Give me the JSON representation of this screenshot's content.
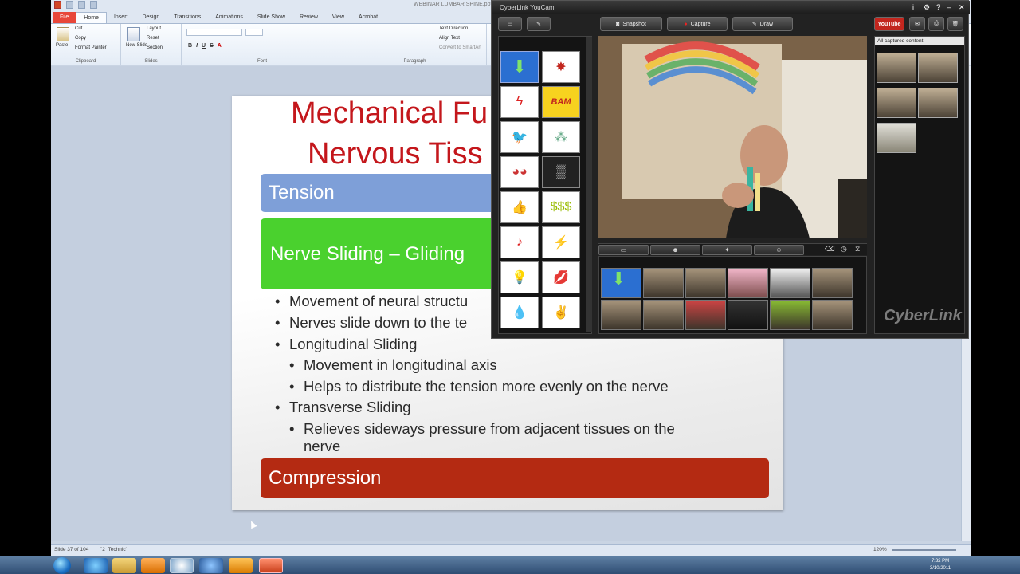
{
  "powerpoint": {
    "file_name": "WEBINAR LUMBAR SPINE.pptx",
    "tabs": [
      "File",
      "Home",
      "Insert",
      "Design",
      "Transitions",
      "Animations",
      "Slide Show",
      "Review",
      "View",
      "Acrobat"
    ],
    "clipboard": {
      "paste": "Paste",
      "cut": "Cut",
      "copy": "Copy",
      "format_painter": "Format Painter",
      "group": "Clipboard"
    },
    "slides_group": {
      "new_slide": "New Slide",
      "layout": "Layout",
      "reset": "Reset",
      "section": "Section",
      "group": "Slides"
    },
    "font_group": "Font",
    "paragraph_group": {
      "text_direction": "Text Direction",
      "align_text": "Align Text",
      "smartart": "Convert to SmartArt",
      "group": "Paragraph"
    },
    "status": {
      "slide": "Slide 37 of 104",
      "theme": "\"2_Technic\"",
      "zoom": "120%"
    }
  },
  "slide": {
    "title_line1": "Mechanical Fu",
    "title_line2": "Nervous Tiss",
    "tension": "Tension",
    "sliding": "Nerve Sliding – Gliding",
    "bullets": [
      "Movement of neural structu",
      "Nerves slide down to the te",
      "Longitudinal Sliding",
      "Movement in longitudinal axis",
      "Helps to distribute the tension more evenly on the nerve",
      "Transverse Sliding",
      "Relieves sideways pressure from adjacent tissues on the",
      "nerve"
    ],
    "compression": "Compression"
  },
  "youcam": {
    "title": "CyberLink YouCam",
    "snapshot": "Snapshot",
    "capture": "Capture",
    "draw": "Draw",
    "youtube": "YouTube",
    "filter": "All captured content",
    "brand": "CyberLink"
  },
  "taskbar": {
    "time": "7:32 PM",
    "date": "3/10/2011"
  },
  "colors": {
    "title_red": "#c4171c",
    "tension": "#7e9fd8",
    "sliding": "#4ad12e",
    "compression": "#b42a12"
  }
}
